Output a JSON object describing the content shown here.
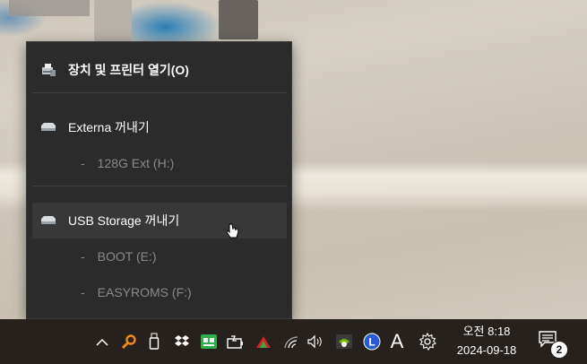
{
  "menu": {
    "open_devices": "장치 및 프린터 열기(O)",
    "drive1": {
      "eject_label": "Externa 꺼내기",
      "volumes": [
        "128G Ext (H:)"
      ]
    },
    "drive2": {
      "eject_label": "USB Storage 꺼내기",
      "volumes": [
        "BOOT (E:)",
        "EASYROMS (F:)"
      ]
    },
    "dash": "-"
  },
  "taskbar": {
    "tray_icons": [
      "chevron-up-icon",
      "search-magnifier-icon",
      "usb-drive-icon",
      "dropbox-icon",
      "green-app-icon",
      "battery-charging-icon",
      "red-green-app-icon",
      "wifi-icon",
      "volume-icon",
      "nvidia-icon",
      "l-circle-icon",
      "font-a-icon",
      "gear-icon"
    ],
    "font_a_glyph": "A",
    "l_glyph": "L",
    "clock_time": "오전 8:18",
    "clock_date": "2024-09-18",
    "notification_count": "2"
  },
  "colors": {
    "menu_bg": "#2b2b2b",
    "hover_bg": "#383838",
    "muted_text": "#8a8a8a",
    "taskbar_bg": "#27211d"
  }
}
